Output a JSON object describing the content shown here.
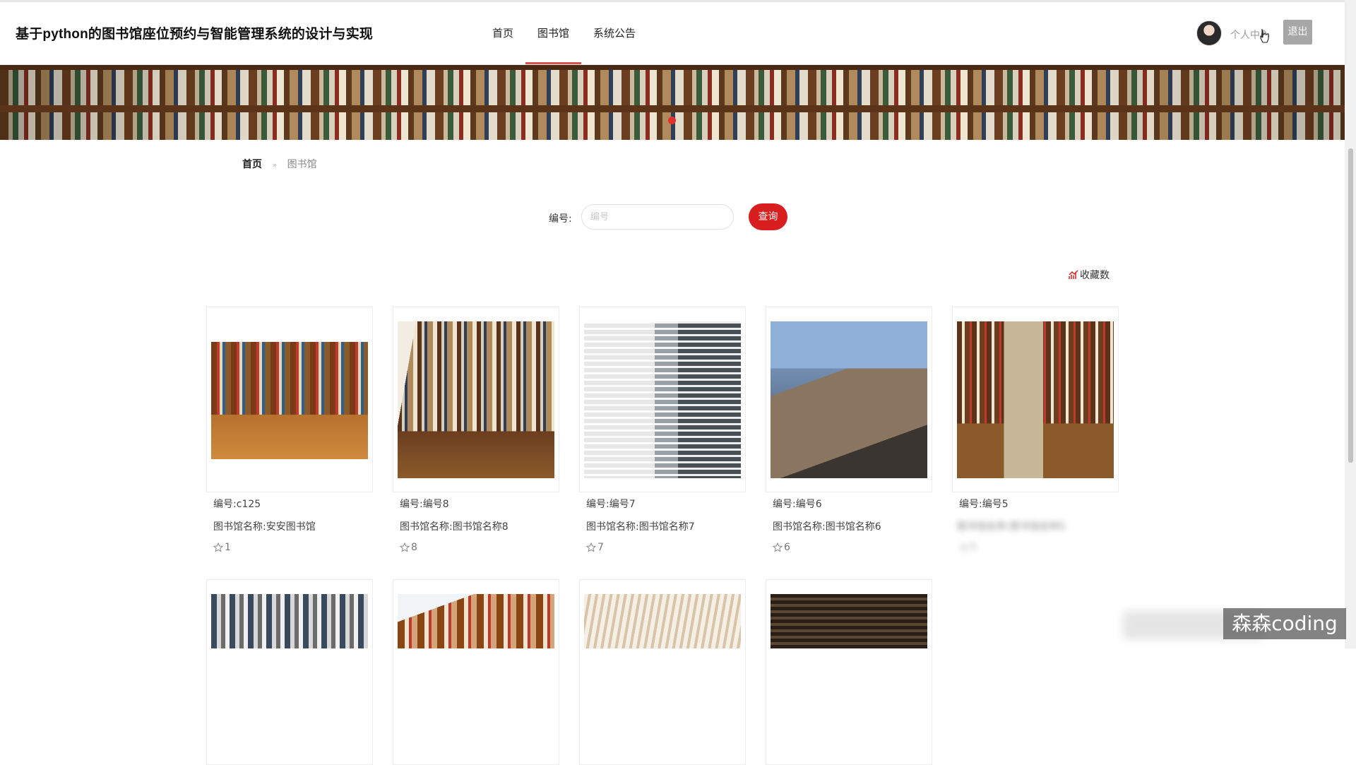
{
  "header": {
    "title": "基于python的图书馆座位预约与智能管理系统的设计与实现",
    "nav": [
      {
        "label": "首页",
        "active": false
      },
      {
        "label": "图书馆",
        "active": true
      },
      {
        "label": "系统公告",
        "active": false
      }
    ],
    "user_center": "个人中心",
    "logout": "退出"
  },
  "breadcrumb": {
    "home": "首页",
    "separator": "»",
    "current": "图书馆"
  },
  "search": {
    "label": "编号:",
    "placeholder": "编号",
    "value": "",
    "button": "查询"
  },
  "sort": {
    "label": "收藏数",
    "icon": "chart-icon"
  },
  "libraries": [
    {
      "code": "编号:c125",
      "name": "图书馆名称:安安图书馆",
      "favorites": "1"
    },
    {
      "code": "编号:编号8",
      "name": "图书馆名称:图书馆名称8",
      "favorites": "8"
    },
    {
      "code": "编号:编号7",
      "name": "图书馆名称:图书馆名称7",
      "favorites": "7"
    },
    {
      "code": "编号:编号6",
      "name": "图书馆名称:图书馆名称6",
      "favorites": "6"
    },
    {
      "code": "编号:编号5",
      "name": "图书馆名称:图书馆名称5",
      "favorites": "5"
    }
  ],
  "watermark": "森森coding",
  "colors": {
    "accent": "#d81e1e",
    "nav_underline": "#d9534f",
    "banner_dot": "#e0332e",
    "logout_bg": "#a7a7a7"
  }
}
